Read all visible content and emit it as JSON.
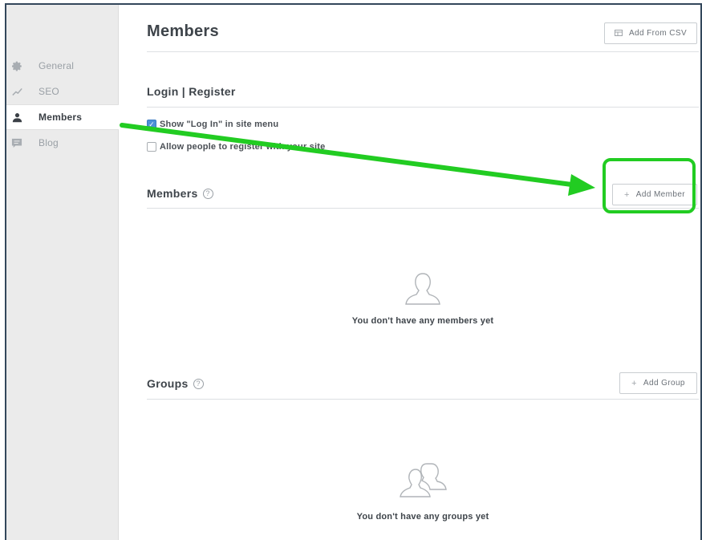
{
  "sidebar": {
    "items": [
      {
        "label": "General",
        "icon": "gear-icon"
      },
      {
        "label": "SEO",
        "icon": "trend-icon"
      },
      {
        "label": "Members",
        "icon": "person-icon",
        "active": true
      },
      {
        "label": "Blog",
        "icon": "comment-icon"
      }
    ]
  },
  "header": {
    "title": "Members",
    "csv_button": "Add From CSV"
  },
  "login": {
    "title": "Login | Register",
    "show_login": {
      "label": "Show \"Log In\" in site menu",
      "checked": true
    },
    "allow_register": {
      "label": "Allow people to register with your site",
      "checked": false
    }
  },
  "members": {
    "title": "Members",
    "help": "?",
    "add_button": "Add Member",
    "empty_text": "You don't have any members yet"
  },
  "groups": {
    "title": "Groups",
    "help": "?",
    "add_button": "Add Group",
    "empty_text": "You don't have any groups yet"
  },
  "annotation": {
    "arrow_color": "#22cc22",
    "highlight_color": "#22cc22"
  }
}
